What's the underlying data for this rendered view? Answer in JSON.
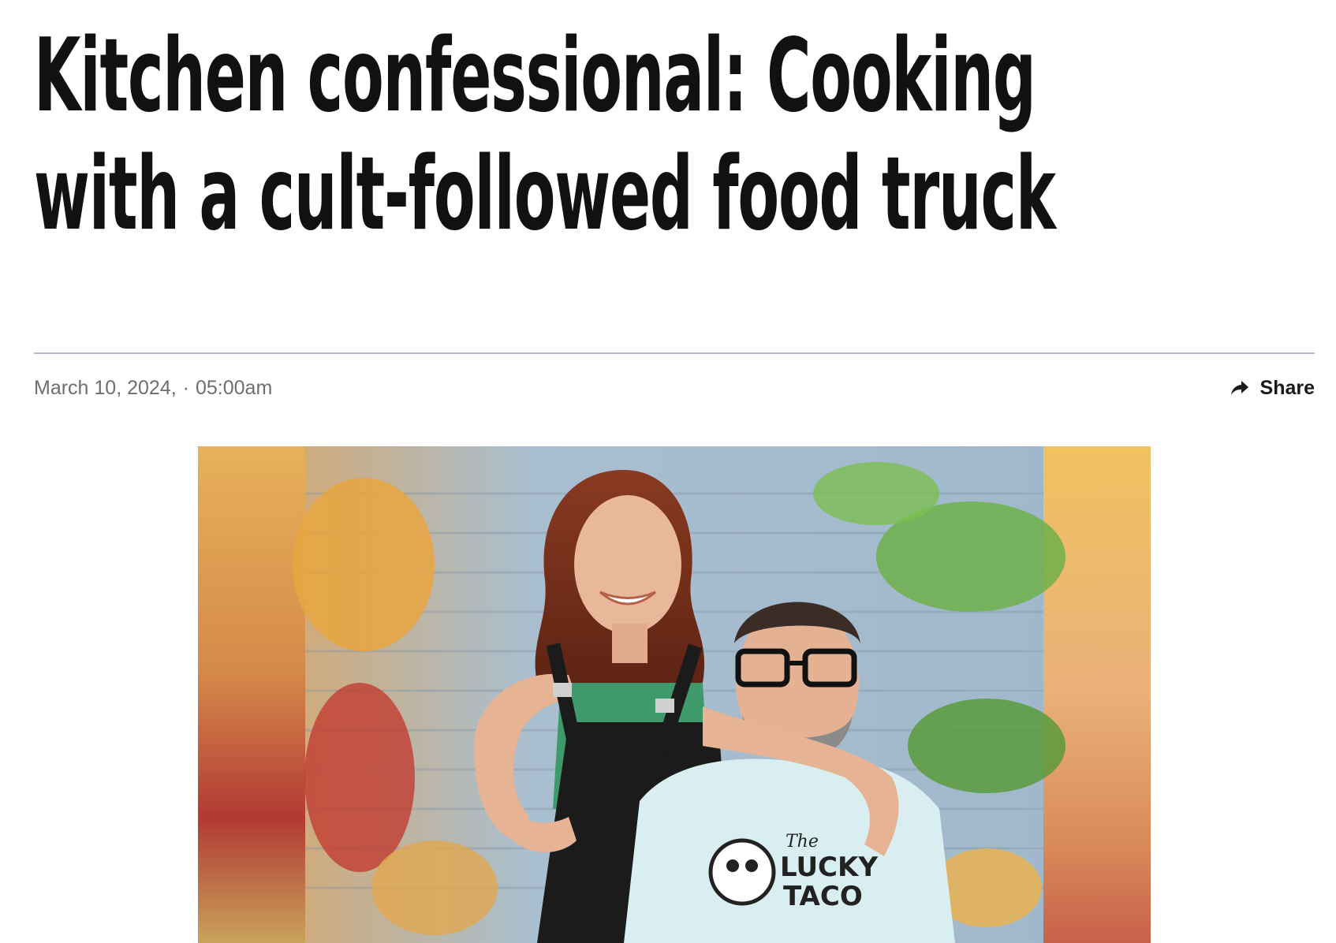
{
  "article": {
    "headline_line1": "Kitchen confessional: Cooking",
    "headline_line2": "with a cult-followed food truck",
    "date": "March 10, 2024,",
    "separator": "·",
    "time": "05:00am"
  },
  "toolbar": {
    "share_label": "Share",
    "share_icon": "share-arrow-icon"
  },
  "hero_image": {
    "shirt_text_line1": "The",
    "shirt_text_line2": "LUCKY",
    "shirt_text_line3": "TACO"
  },
  "colors": {
    "divider": "#b9b6e6",
    "meta_text": "#6e6e6e",
    "headline": "#111111"
  }
}
